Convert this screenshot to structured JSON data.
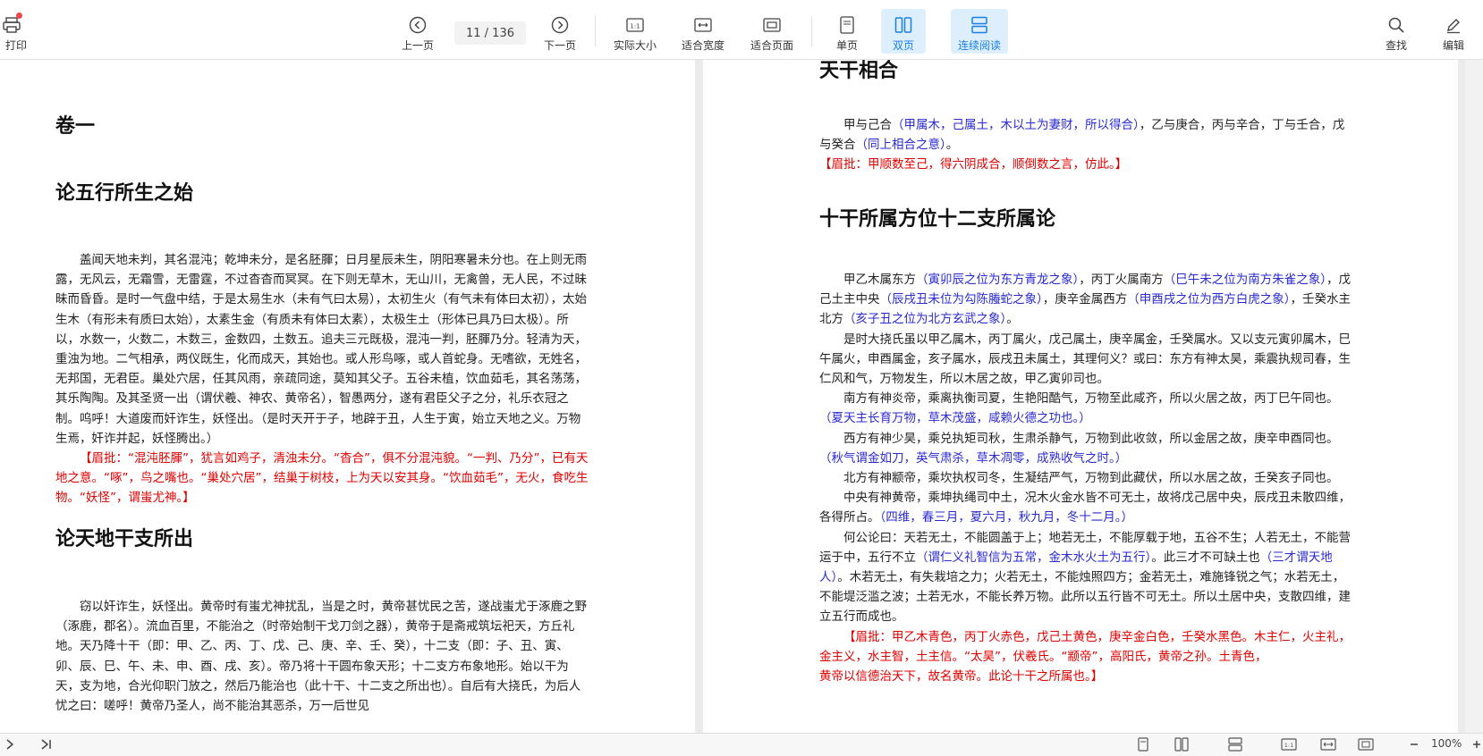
{
  "toolbar": {
    "print_label": "打印",
    "prev_label": "上一页",
    "page_indicator": "11 / 136",
    "next_label": "下一页",
    "actual_size_label": "实际大小",
    "fit_width_label": "适合宽度",
    "fit_page_label": "适合页面",
    "single_label": "单页",
    "double_label": "双页",
    "continuous_label": "连续阅读",
    "search_label": "查找",
    "edit_label": "编辑",
    "accent_color": "#1a7fe6",
    "badge_color": "#f04848"
  },
  "left_page": {
    "volume_title": "卷一",
    "sec1_title": "论五行所生之始",
    "sec1_p1": "盖闻天地未判，其名混沌；乾坤未分，是名胚腪；日月星辰未生，阴阳寒暑未分也。在上则无雨露，无风云，无霜雪，无雷霆，不过杳杳而冥冥。在下则无草木，无山川，无禽兽，无人民，不过昧昧而昏昏。是时一气盘中结，于是太易生水（未有气曰太易），太初生火（有气未有体曰太初），太始生木（有形未有质曰太始），太素生金（有质未有体曰太素），太极生土（形体已具乃曰太极）。所以，水数一，火数二，木数三，金数四，土数五。追夫三元既极，混沌一判，胚腪乃分。轻清为天，重浊为地。二气相承，两仪既生，化而成天，其始也。或人形鸟啄，或人首蛇身。无嗜欲，无姓名，无邦国，无君臣。巢处穴居，任其风雨，亲疏同途，莫知其父子。五谷未植，饮血茹毛，其名荡荡，其乐陶陶。及其圣贤一出（谓伏羲、神农、黄帝名），智愚两分，遂有君臣父子之分，礼乐衣冠之制。呜呼！大道废而奸诈生，妖怪出。（是时天开于子，地辟于丑，人生于寅，始立天地之义。万物生焉，奸诈并起，妖怪腾出。）",
    "sec1_comment": "【眉批：“混沌胚腪”，犹言如鸡子，清浊未分。“杳合”，俱不分混沌貌。“一判、乃分”，已有天地之意。“啄”，鸟之嘴也。“巢处穴居”，结巢于树枝，上为天以安其身。“饮血茹毛”，无火，食吃生物。“妖怪”，谓蚩尤神。】",
    "sec2_title": "论天地干支所出",
    "sec2_p1": "窃以奸诈生，妖怪出。黄帝时有蚩尤神扰乱，当是之时，黄帝甚忧民之苦，遂战蚩尤于涿鹿之野（涿鹿，郡名）。流血百里，不能治之（时帝始制干戈刀剑之器），黄帝于是斋戒筑坛祀天，方丘礼地。天乃降十干（即：甲、乙、丙、丁、戊、己、庚、辛、壬、癸），十二支（即：子、丑、寅、卯、辰、巳、午、未、申、酉、戌、亥）。帝乃将十干圆布象天形；十二支方布象地形。始以干为天，支为地，合光仰职门放之，然后乃能治也（此十干、十二支之所出也）。自后有大挠氏，为后人忧之曰：嗟呼！黄帝乃圣人，尚不能治其恶杀，万一后世见"
  },
  "right_page": {
    "sec0_title": "天干相合",
    "sec0_p1a": "甲与己合",
    "sec0_p1b": "（甲属木，己属土，木以土为妻财，所以得合）",
    "sec0_p1c": "，乙与庚合，丙与辛合，丁与壬合，戊与癸合",
    "sec0_p1d": "（同上相合之意）",
    "sec0_p1e": "。",
    "sec0_comment": "【眉批：甲顺数至己，得六阴成合，顺倒数之言，仿此。】",
    "sec1_title": "十干所属方位十二支所属论",
    "p1a": "甲乙木属东方",
    "p1b": "（寅卯辰之位为东方青龙之象）",
    "p1c": "，丙丁火属南方",
    "p1d": "（巳午未之位为南方朱雀之象）",
    "p1e": "，戊己土主中央",
    "p1f": "（辰戌丑未位为勾陈螣蛇之象）",
    "p1g": "，庚辛金属西方",
    "p1h": "（申酉戌之位为西方白虎之象）",
    "p1i": "，壬癸水主北方",
    "p1j": "（亥子丑之位为北方玄武之象）",
    "p1k": "。",
    "p2": "是时大挠氏虽以甲乙属木，丙丁属火，戊己属土，庚辛属金，壬癸属水。又以支元寅卯属木，巳午属火，申酉属金，亥子属水，辰戌丑未属土，其理何义？或曰：东方有神太昊，乘震执规司春，生仁风和气，万物发生，所以木居之故，甲乙寅卯司也。",
    "p3a": "南方有神炎帝，乘离执衡司夏，生艳阳酷气，万物至此咸齐，所以火居之故，丙丁巳午同也。",
    "p3b": "（夏天主长育万物，草木茂盛，咸赖火德之功也。）",
    "p4a": "西方有神少昊，乘兑执矩司秋，生肃杀静气，万物到此收敛，所以金居之故，庚辛申酉同也。",
    "p4b": "（秋气谓金如刀，英气肃杀，草木凋零，成熟收气之时。）",
    "p5": "北方有神颛帝，乘坎执权司冬，生凝结严气，万物到此藏伏，所以水居之故，壬癸亥子同也。",
    "p6a": "中央有神黄帝，乘坤执绳司中土，况木火金水皆不可无土，故将戊己居中央，辰戌丑未散四维，各得所占。",
    "p6b": "（四维，春三月，夏六月，秋九月，冬十二月。）",
    "p7a": "何公论曰：天若无土，不能圆盖于上；地若无土，不能厚载于地，五谷不生；人若无土，不能营运于中，五行不立",
    "p7b": "（谓仁义礼智信为五常，金木水火土为五行）",
    "p7c": "。此三才不可缺土也",
    "p7d": "（三才谓天地人）",
    "p7e": "。木若无土，有失栽培之力；火若无土，不能烛照四方；金若无土，难施锋锐之气；水若无土，不能堤泛滥之波；土若无水，不能长养万物。此所以五行皆不可无土。所以土居中央，支散四维，建立五行而成也。",
    "comment2a": "【眉批：甲乙木青色，丙丁火赤色，戊己土黄色，庚辛金白色，壬癸水黑色。木主仁，火主礼，金主义，水主智，土主信。“太昊”，伏羲氏。“颛帝”，高阳氏，黄帝之孙。土青色，",
    "comment2b": "黄帝以信德治天下，故名黄帝。此论十干之所属也。】"
  },
  "statusbar": {
    "zoom": "100%"
  }
}
